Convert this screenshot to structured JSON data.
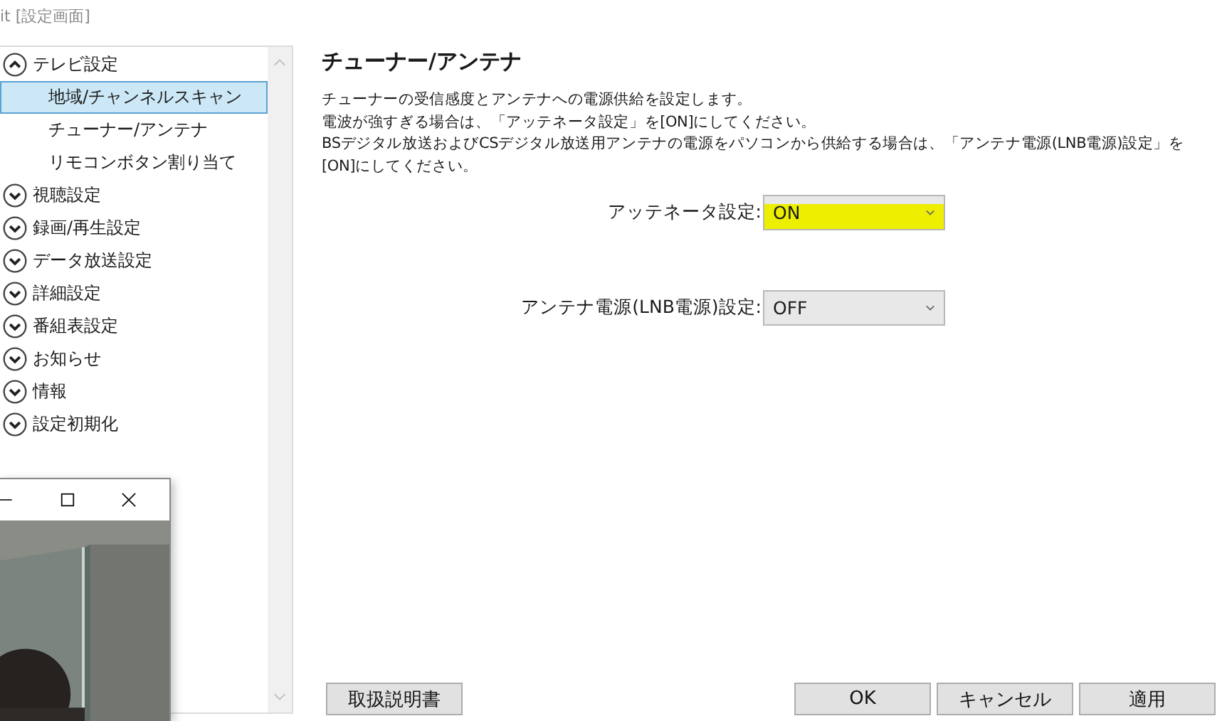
{
  "window": {
    "title": "it [設定画面]"
  },
  "sidebar": {
    "items": [
      {
        "label": "テレビ設定",
        "expanded": true,
        "selected": false,
        "children": [
          {
            "label": "地域/チャンネルスキャン",
            "selected": true
          },
          {
            "label": "チューナー/アンテナ",
            "selected": false
          },
          {
            "label": "リモコンボタン割り当て",
            "selected": false
          }
        ]
      },
      {
        "label": "視聴設定",
        "expanded": false,
        "selected": false
      },
      {
        "label": "録画/再生設定",
        "expanded": false,
        "selected": false
      },
      {
        "label": "データ放送設定",
        "expanded": false,
        "selected": false
      },
      {
        "label": "詳細設定",
        "expanded": false,
        "selected": false
      },
      {
        "label": "番組表設定",
        "expanded": false,
        "selected": false
      },
      {
        "label": "お知らせ",
        "expanded": false,
        "selected": false
      },
      {
        "label": "情報",
        "expanded": false,
        "selected": false
      },
      {
        "label": "設定初期化",
        "expanded": false,
        "selected": false
      }
    ]
  },
  "panel": {
    "heading": "チューナー/アンテナ",
    "description": [
      "チューナーの受信感度とアンテナへの電源供給を設定します。",
      "電波が強すぎる場合は、「アッテネータ設定」を[ON]にしてください。",
      "BSデジタル放送およびCSデジタル放送用アンテナの電源をパソコンから供給する場合は、「アンテナ電源(LNB電源)設定」を[ON]にしてください。"
    ],
    "settings": [
      {
        "label": "アッテネータ設定:",
        "value": "ON",
        "highlighted": true
      },
      {
        "label": "アンテナ電源(LNB電源)設定:",
        "value": "OFF",
        "highlighted": false
      }
    ]
  },
  "buttons": {
    "manual": "取扱説明書",
    "actions": [
      "OK",
      "キャンセル",
      "適用"
    ]
  }
}
